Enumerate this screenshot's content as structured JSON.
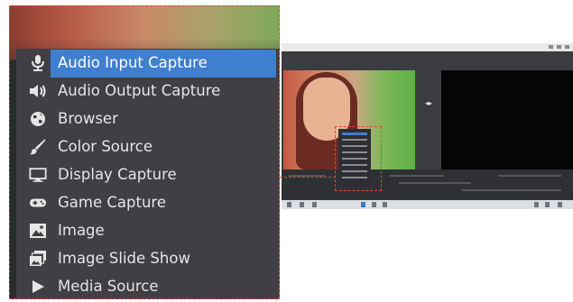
{
  "source_menu": {
    "items": [
      {
        "label": "Audio Input Capture",
        "icon": "microphone-icon",
        "selected": true
      },
      {
        "label": "Audio Output Capture",
        "icon": "speaker-icon",
        "selected": false
      },
      {
        "label": "Browser",
        "icon": "globe-icon",
        "selected": false
      },
      {
        "label": "Color Source",
        "icon": "brush-icon",
        "selected": false
      },
      {
        "label": "Display Capture",
        "icon": "monitor-icon",
        "selected": false
      },
      {
        "label": "Game Capture",
        "icon": "gamepad-icon",
        "selected": false
      },
      {
        "label": "Image",
        "icon": "image-icon",
        "selected": false
      },
      {
        "label": "Image Slide Show",
        "icon": "slideshow-icon",
        "selected": false
      },
      {
        "label": "Media Source",
        "icon": "play-icon",
        "selected": false
      }
    ]
  },
  "colors": {
    "menu_background": "#3f3f44",
    "selection": "#3f7fd0",
    "callout_dash": "#e0463c",
    "preview_right": "#050505"
  }
}
